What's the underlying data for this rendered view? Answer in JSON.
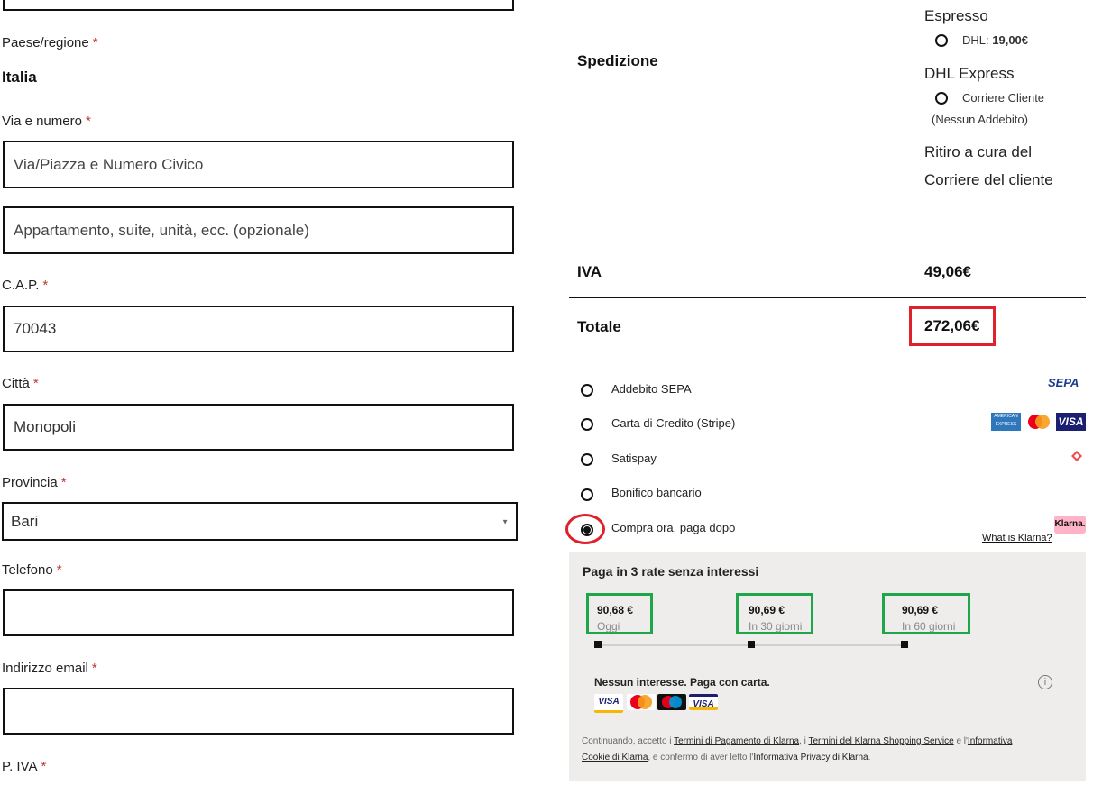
{
  "form": {
    "country_label": "Paese/regione",
    "country_value": "Italia",
    "street_label": "Via e numero",
    "street_placeholder": "Via/Piazza e Numero Civico",
    "apt_placeholder": "Appartamento, suite, unità, ecc. (opzionale)",
    "cap_label": "C.A.P.",
    "cap_value": "70043",
    "city_label": "Città",
    "city_value": "Monopoli",
    "province_label": "Provincia",
    "province_value": "Bari",
    "phone_label": "Telefono",
    "email_label": "Indirizzo email",
    "vat_label": "P. IVA",
    "required_mark": "*"
  },
  "summary": {
    "shipping_label": "Spedizione",
    "options": {
      "espresso_title": "Espresso",
      "dhl_prefix": "DHL:",
      "dhl_price": "19,00€",
      "express_title": "DHL Express",
      "courier_label": "Corriere Cliente",
      "courier_note": "(Nessun Addebito)",
      "pickup_line1": "Ritiro a cura del",
      "pickup_line2": "Corriere del cliente"
    },
    "iva_label": "IVA",
    "iva_value": "49,06€",
    "total_label": "Totale",
    "total_value": "272,06€"
  },
  "payment": {
    "methods": [
      {
        "label": "Addebito SEPA",
        "logo": "SEPA",
        "selected": false
      },
      {
        "label": "Carta di Credito (Stripe)",
        "logo": "cards",
        "selected": false
      },
      {
        "label": "Satispay",
        "logo": "satispay-icon",
        "selected": false
      },
      {
        "label": "Bonifico bancario",
        "logo": "",
        "selected": false
      },
      {
        "label": "Compra ora, paga dopo",
        "logo": "Klarna.",
        "selected": true
      }
    ],
    "card_logos": {
      "amex": "AMERICAN EXPRESS",
      "visa": "VISA"
    },
    "klarna_link": "What is Klarna?"
  },
  "klarna": {
    "heading": "Paga in 3 rate senza interessi",
    "rates": [
      {
        "amount": "90,68 €",
        "when": "Oggi"
      },
      {
        "amount": "90,69 €",
        "when": "In 30 giorni"
      },
      {
        "amount": "90,69 €",
        "when": "In 60 giorni"
      }
    ],
    "no_interest": "Nessun interesse. Paga con carta.",
    "card_visa": "VISA",
    "legal": {
      "p1": "Continuando, accetto i ",
      "l1": "Termini di Pagamento di Klarna",
      "p2": ", i ",
      "l2": "Termini del Klarna Shopping Service",
      "p3": " e l'",
      "l3": "Informativa",
      "l3b": "Cookie di Klarna",
      "p4": ", e confermo di aver letto l'",
      "l4": "Informativa Privacy di Klarna",
      "p5": "."
    }
  },
  "colors": {
    "red_highlight": "#e0202a",
    "green_highlight": "#1fa64a",
    "klarna_pink": "#ffb3c7",
    "visa_blue": "#1a1f71"
  }
}
